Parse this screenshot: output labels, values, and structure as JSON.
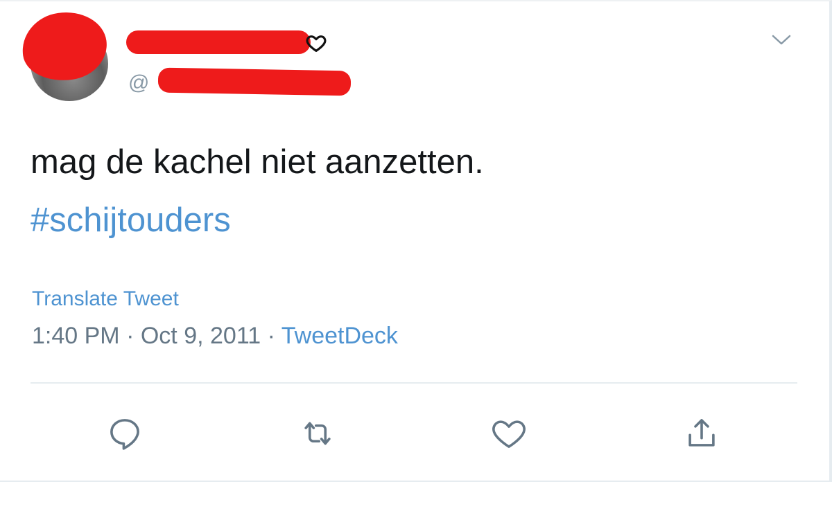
{
  "tweet": {
    "handle_prefix": "@",
    "text_line": "mag de kachel niet aanzetten.",
    "hashtag": "#schijtouders",
    "translate_label": "Translate Tweet",
    "time": "1:40 PM",
    "separator": "·",
    "date": "Oct 9, 2011",
    "source": "TweetDeck"
  },
  "icons": {
    "menu": "chevron-down-icon",
    "name_badge": "heart-icon",
    "reply": "reply-icon",
    "retweet": "retweet-icon",
    "like": "like-icon",
    "share": "share-icon"
  },
  "colors": {
    "link": "#4e93d1",
    "text": "#14171a",
    "muted": "#657786",
    "icon": "#657786",
    "redaction": "#ee1b1b"
  }
}
